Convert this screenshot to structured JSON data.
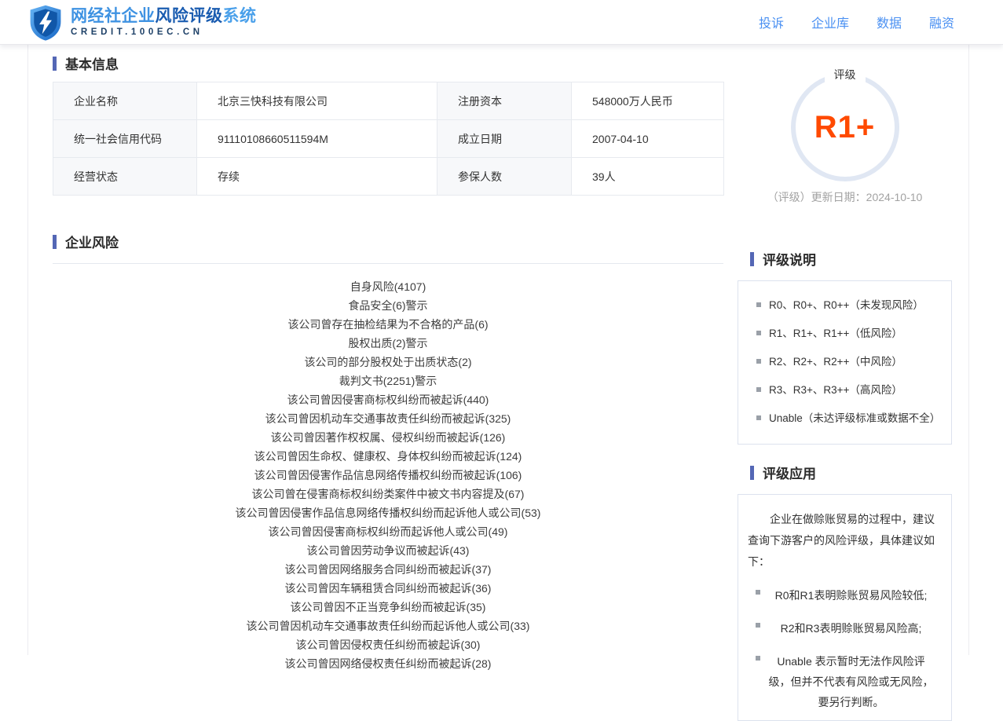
{
  "header": {
    "brand": {
      "part1": "网经社企业",
      "part2": "风险评级",
      "part3": "系统",
      "line2": "CREDIT.100EC.CN"
    },
    "nav": [
      "投诉",
      "企业库",
      "数据",
      "融资"
    ]
  },
  "basic_info": {
    "title": "基本信息",
    "rows": [
      {
        "label1": "企业名称",
        "value1": "北京三快科技有限公司",
        "label2": "注册资本",
        "value2": "548000万人民币"
      },
      {
        "label1": "统一社会信用代码",
        "value1": "91110108660511594M",
        "label2": "成立日期",
        "value2": "2007-04-10"
      },
      {
        "label1": "经营状态",
        "value1": "存续",
        "label2": "参保人数",
        "value2": "39人"
      }
    ]
  },
  "rating": {
    "label": "评级",
    "value": "R1+",
    "update": "（评级）更新日期：2024-10-10"
  },
  "risk": {
    "title": "企业风险",
    "items": [
      "自身风险(4107)",
      "食品安全(6)警示",
      "该公司曾存在抽检结果为不合格的产品(6)",
      "股权出质(2)警示",
      "该公司的部分股权处于出质状态(2)",
      "裁判文书(2251)警示",
      "该公司曾因侵害商标权纠纷而被起诉(440)",
      "该公司曾因机动车交通事故责任纠纷而被起诉(325)",
      "该公司曾因著作权权属、侵权纠纷而被起诉(126)",
      "该公司曾因生命权、健康权、身体权纠纷而被起诉(124)",
      "该公司曾因侵害作品信息网络传播权纠纷而被起诉(106)",
      "该公司曾在侵害商标权纠纷类案件中被文书内容提及(67)",
      "该公司曾因侵害作品信息网络传播权纠纷而起诉他人或公司(53)",
      "该公司曾因侵害商标权纠纷而起诉他人或公司(49)",
      "该公司曾因劳动争议而被起诉(43)",
      "该公司曾因网络服务合同纠纷而被起诉(37)",
      "该公司曾因车辆租赁合同纠纷而被起诉(36)",
      "该公司曾因不正当竞争纠纷而被起诉(35)",
      "该公司曾因机动车交通事故责任纠纷而起诉他人或公司(33)",
      "该公司曾因侵权责任纠纷而被起诉(30)",
      "该公司曾因网络侵权责任纠纷而被起诉(28)"
    ]
  },
  "legend": {
    "title": "评级说明",
    "items": [
      "R0、R0+、R0++（未发现风险）",
      "R1、R1+、R1++（低风险）",
      "R2、R2+、R2++（中风险）",
      "R3、R3+、R3++（高风险）",
      "Unable（未达评级标准或数据不全）"
    ]
  },
  "usage": {
    "title": "评级应用",
    "intro": "企业在做赊账贸易的过程中，建议查询下游客户的风险评级，具体建议如下：",
    "items": [
      "R0和R1表明赊账贸易风险较低;",
      "R2和R3表明赊账贸易风险高;",
      "Unable 表示暂时无法作风险评级，但并不代表有风险或无风险，要另行判断。"
    ]
  },
  "colors": {
    "nav_blue": "#4a90f2",
    "section_bar_indigo": "#5467b5",
    "rating_orange": "#ff4a00",
    "circle_arc": "#e0e7f3",
    "brand_blue_dark": "#1a5cb0"
  }
}
